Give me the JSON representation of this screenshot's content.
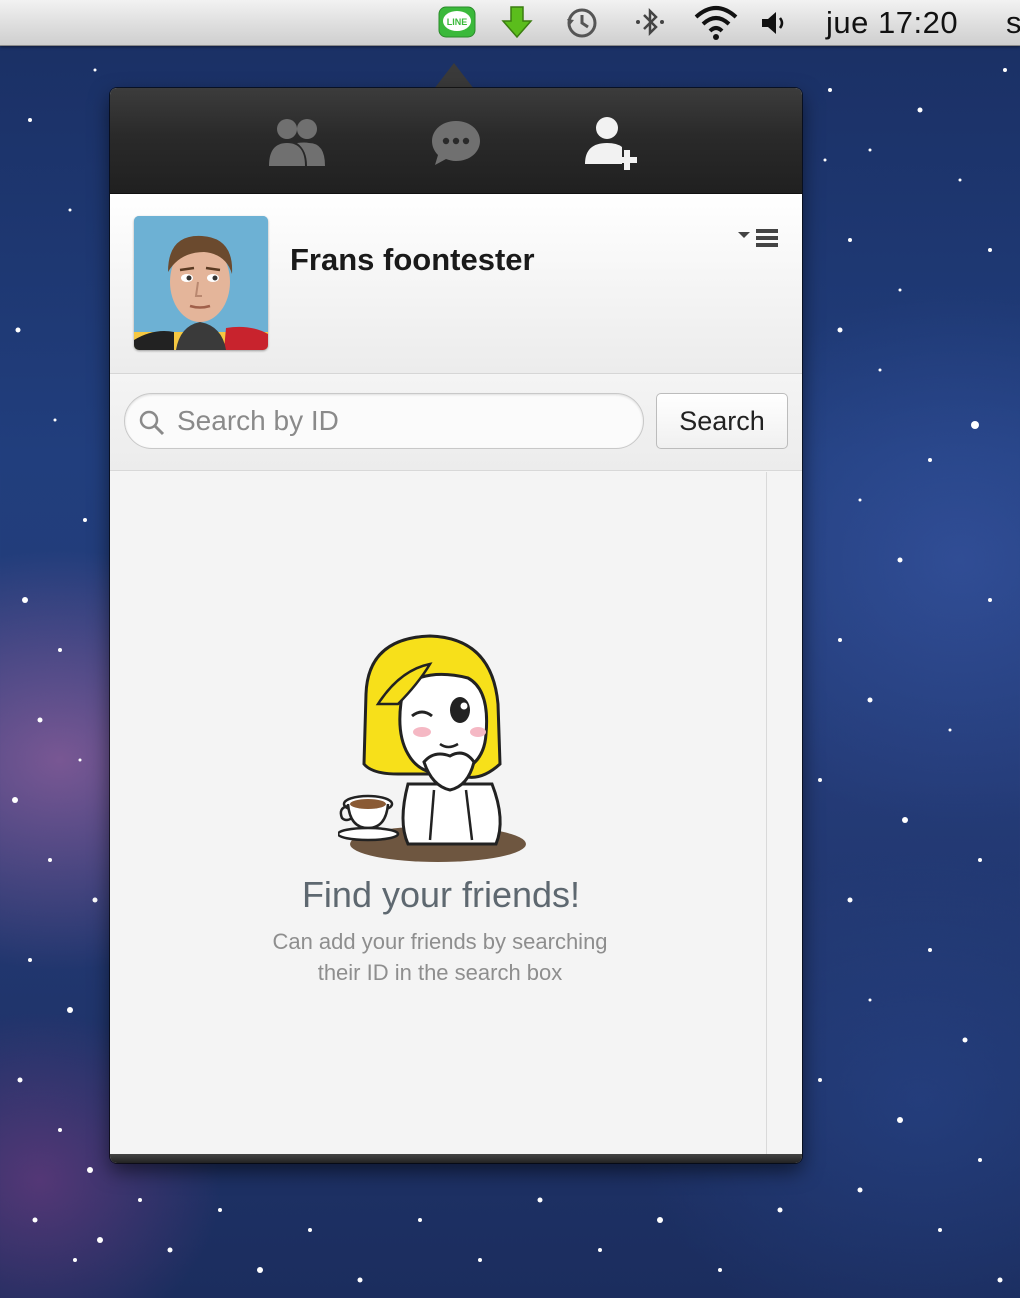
{
  "menubar": {
    "clock": "jue 17:20",
    "trailing_text": "s",
    "icons": [
      "line-app-icon",
      "download-arrow-icon",
      "time-machine-icon",
      "bluetooth-icon",
      "wifi-icon",
      "volume-icon"
    ]
  },
  "tabs": [
    {
      "name": "friends",
      "icon": "friends-icon",
      "active": false
    },
    {
      "name": "chats",
      "icon": "chat-icon",
      "active": false
    },
    {
      "name": "add-friend",
      "icon": "add-friend-icon",
      "active": true
    }
  ],
  "profile": {
    "name": "Frans foontester",
    "menu_icon": "menu-dropdown-icon"
  },
  "search": {
    "placeholder": "Search by ID",
    "value": "",
    "button_label": "Search"
  },
  "empty_state": {
    "title": "Find your friends!",
    "description_line1": "Can add your friends by searching",
    "description_line2": "their ID in the search box"
  },
  "colors": {
    "line_green": "#3ab93a",
    "tabbar_dark": "#2a2a2a",
    "title_gray": "#5e6870"
  }
}
